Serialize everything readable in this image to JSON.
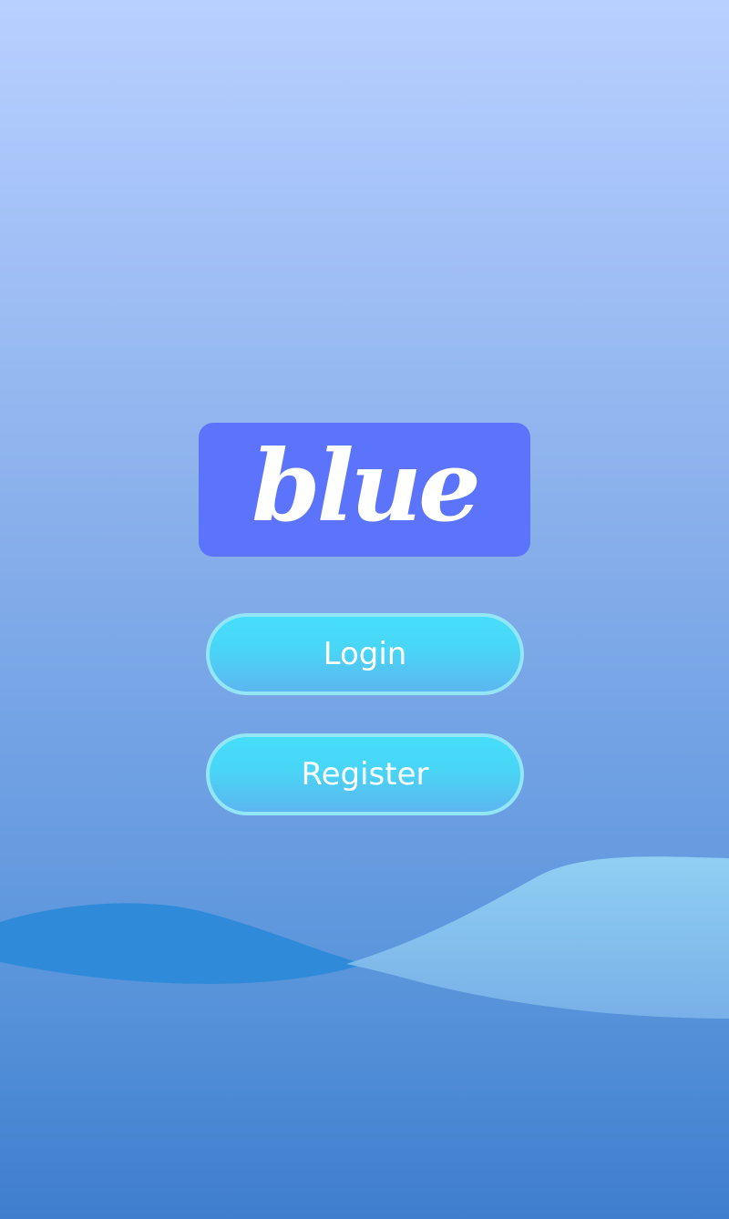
{
  "app": {
    "logo_text": "blue"
  },
  "actions": {
    "login_label": "Login",
    "register_label": "Register"
  },
  "colors": {
    "background_top": "#b8d0ff",
    "background_bottom": "#3f7ece",
    "logo_box": "#5c74fc",
    "button_fill_top": "#46defa",
    "button_fill_bottom": "#5cb6f0",
    "button_border": "#93e6f6",
    "wave_dark": "#2a8ad8",
    "wave_light": "#9ad4f4"
  }
}
